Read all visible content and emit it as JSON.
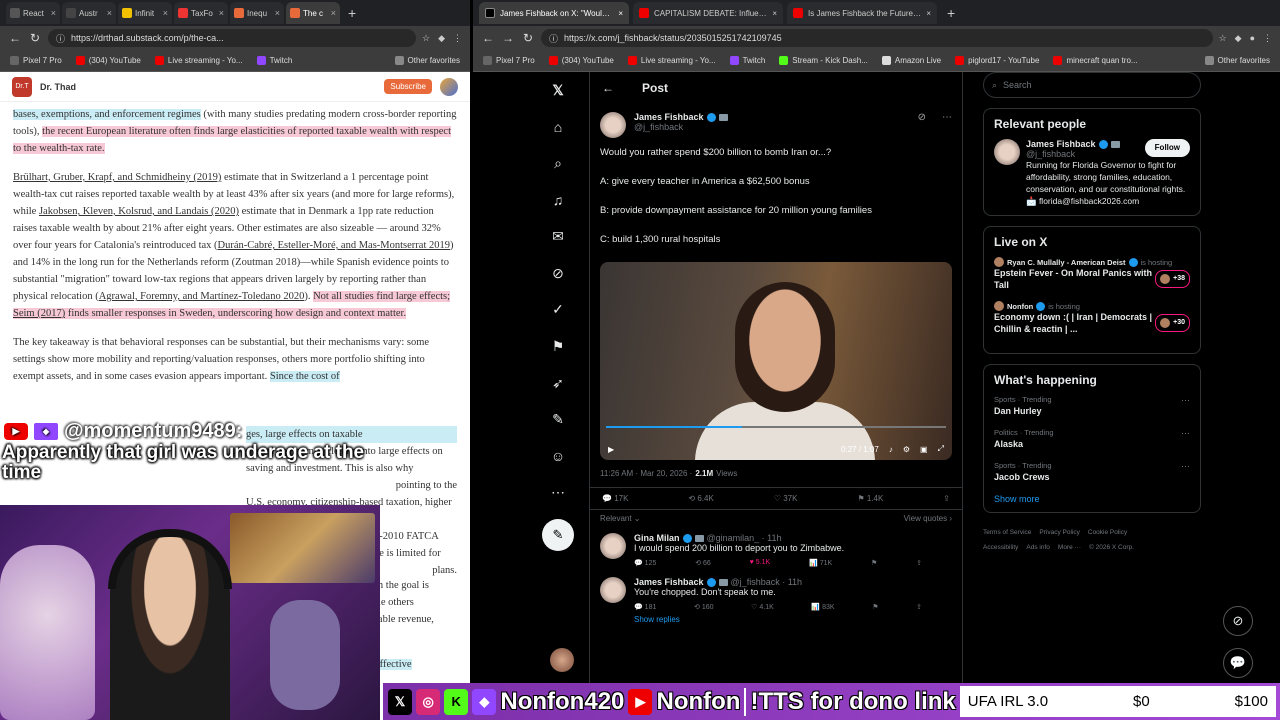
{
  "left_browser": {
    "tabs": [
      {
        "label": "React",
        "color": "#555"
      },
      {
        "label": "Austr",
        "color": "#444"
      },
      {
        "label": "Infinit",
        "color": "#f2c200"
      },
      {
        "label": "TaxFo",
        "color": "#e33"
      },
      {
        "label": "Inequ",
        "color": "#e86a3a"
      },
      {
        "label": "The c",
        "color": "#e86a3a",
        "active": true
      }
    ],
    "url": "https://drthad.substack.com/p/the-ca...",
    "bookmarks": [
      "Pixel 7 Pro",
      "(304) YouTube",
      "Live streaming - Yo...",
      "Twitch"
    ],
    "other_favorites": "Other favorites",
    "site_name": "Dr. Thad",
    "logo_text": "Dr.T",
    "subscribe": "Subscribe",
    "p1a": "bases, exemptions, and enforcement regimes",
    "p1b": " (with many studies predating modern cross-border reporting tools), ",
    "p1c": "the recent European literature often finds large elasticities of reported taxable wealth with respect to the wealth-tax rate.",
    "p2_link1": "Brülhart, Gruber, Krapf, and Schmidheiny (2019)",
    "p2_a": " estimate that in Switzerland a 1 percentage point wealth-tax cut raises reported taxable wealth by at least 43% after six years (and more for large reforms), while ",
    "p2_link2": "Jakobsen, Kleven, Kolsrud, and Landais (2020)",
    "p2_b": " estimate that in Denmark a 1pp rate reduction raises taxable wealth by about 21% after eight years. Other estimates are also sizeable — around 32% over four years for Catalonia's reintroduced tax (",
    "p2_link3": "Durán-Cabré, Esteller-Moré, and Mas-Montserrat 2019",
    "p2_c": ") and 14% in the long run for the Netherlands reform (Zoutman 2018)—while Spanish evidence points to substantial \"migration\" toward low-tax regions that appears driven largely by reporting rather than physical relocation (",
    "p2_link4": "Agrawal, Foremny, and Martínez-Toledano 2020",
    "p2_d": "). ",
    "p2_e": "Not all studies find large effects; ",
    "p2_link5": "Seim (2017)",
    "p2_f": " finds smaller responses in Sweden, underscoring how design and context matter.",
    "p3a": "The key takeaway is that behavioral responses can be substantial, but their mechanisms vary: some settings show more mobility and reporting/valuation responses, others more portfolio shifting into exempt assets, and in some cases evasion appears important. ",
    "p3b": "Since the cost of",
    "p3c": "ges, large effects on taxable",
    "p3d": "wealth do not map cleanly into large effects on saving and investment. This is also why",
    "p3e": "pointing to the",
    "p3f": "U.S. economy, citizenship-based taxation, higher thresholds, stronger",
    "p3g": "enforcement plans, and the post-2010 FATCA environment — though evidence is limited for",
    "p3h": "plans.",
    "p4a": "m the goal is",
    "p4b": "ile others",
    "p4c": "iable revenue,",
    "p4d": "effective"
  },
  "stream": {
    "chat_user": "@momentum9489:",
    "chat_message": "Apparently that girl was underage at the time",
    "banner_handle1": "Nonfon420",
    "banner_handle2": "Nonfon",
    "banner_tts": "!TTS for dono link",
    "goal_label": "UFA IRL 3.0",
    "goal_current": "$0",
    "goal_target": "$100"
  },
  "right_browser": {
    "tabs": [
      {
        "label": "James Fishback on X: \"Would you ...",
        "color": "#000",
        "active": true
      },
      {
        "label": "CAPITALISM DEBATE: Influencers d...",
        "color": "#e00"
      },
      {
        "label": "Is James Fishback the Future of th...",
        "color": "#e00"
      }
    ],
    "url": "https://x.com/j_fishback/status/2035015251742109745",
    "bookmarks": [
      "Pixel 7 Pro",
      "(304) YouTube",
      "Live streaming - Yo...",
      "Twitch",
      "Stream - Kick Dash...",
      "Amazon Live",
      "piglord17 - YouTube",
      "minecraft quan tro..."
    ],
    "other_favorites": "Other favorites"
  },
  "x": {
    "header": "Post",
    "author": "James Fishback",
    "handle": "@j_fishback",
    "question": "Would you rather spend $200 billion to bomb Iran or...?",
    "option_a": "A: give every teacher in America a $62,500 bonus",
    "option_b": "B: provide downpayment assistance for 20 million young families",
    "option_c": "C: build 1,300 rural hospitals",
    "video_time": "0:27 / 1:07",
    "video_progress": 0.4,
    "time": "11:26 AM · Mar 20, 2026 · ",
    "views": "2.1M",
    "views_label": "Views",
    "replies": "17K",
    "reposts": "6.4K",
    "likes": "37K",
    "bookmarks": "1.4K",
    "relevant": "Relevant",
    "view_quotes": "View quotes",
    "reply1": {
      "name": "Gina Milan",
      "handle": "@ginamilan_ · 11h",
      "text": "I would spend 200 billion to deport you to Zimbabwe.",
      "replies": "125",
      "reposts": "66",
      "likes": "5.1K",
      "views": "71K"
    },
    "reply2": {
      "name": "James Fishback",
      "handle": "@j_fishback · 11h",
      "text": "You're chopped. Don't speak to me.",
      "replies": "181",
      "reposts": "160",
      "likes": "4.1K",
      "views": "83K"
    },
    "show_replies": "Show replies",
    "search_placeholder": "Search",
    "relevant_people_title": "Relevant people",
    "rp_name": "James Fishback",
    "rp_handle": "@j_fishback",
    "rp_follow": "Follow",
    "rp_bio": "Running for Florida Governor to fight for affordability, strong families, education, conservation, and our constitutional rights. 📩 florida@fishback2026.com",
    "live_title": "Live on X",
    "live": [
      {
        "host": "Ryan C. Mullally - American Deist",
        "hosting": "is hosting",
        "title": "Epstein Fever - On Moral Panics with Tall",
        "count": "+38"
      },
      {
        "host": "Nonfon",
        "hosting": "is hosting",
        "title": "Economy down :( | Iran | Democrats | Chillin & reactin | ...",
        "count": "+30"
      }
    ],
    "happening_title": "What's happening",
    "trends": [
      {
        "cat": "Sports · Trending",
        "name": "Dan Hurley"
      },
      {
        "cat": "Politics · Trending",
        "name": "Alaska"
      },
      {
        "cat": "Sports · Trending",
        "name": "Jacob Crews"
      }
    ],
    "show_more": "Show more",
    "footer": [
      "Terms of Service",
      "Privacy Policy",
      "Cookie Policy",
      "Accessibility",
      "Ads info",
      "More ···",
      "© 2026 X Corp."
    ]
  }
}
